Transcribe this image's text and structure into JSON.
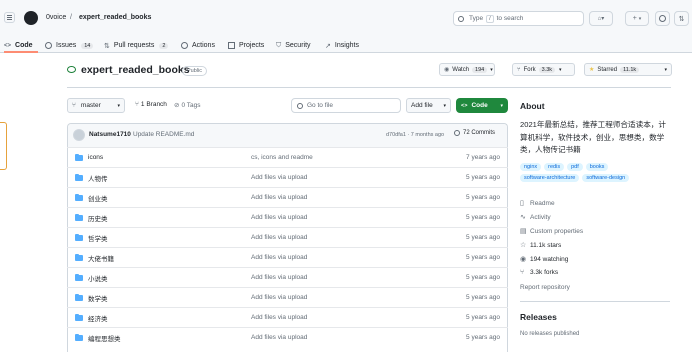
{
  "header": {
    "owner": "0voice",
    "separator": "/",
    "repo": "expert_readed_books",
    "search_placeholder_pre": "Type",
    "search_key": "/",
    "search_placeholder_post": "to search",
    "plus": "+"
  },
  "nav_tabs": [
    {
      "label": "Code"
    },
    {
      "label": "Issues",
      "count": "14"
    },
    {
      "label": "Pull requests",
      "count": "2"
    },
    {
      "label": "Actions"
    },
    {
      "label": "Projects"
    },
    {
      "label": "Security"
    },
    {
      "label": "Insights"
    }
  ],
  "repo": {
    "name": "expert_readed_books",
    "visibility": "Public",
    "watch_label": "Watch",
    "watch_count": "194",
    "fork_label": "Fork",
    "fork_count": "3.3k",
    "star_label": "Starred",
    "star_count": "11.1k"
  },
  "toolbar": {
    "branch": "master",
    "branches": "1 Branch",
    "tags": "0 Tags",
    "goto_placeholder": "Go to file",
    "add_file": "Add file",
    "code_button": "Code"
  },
  "commit": {
    "author": "Natsume1710",
    "message": "Update README.md",
    "sha": "d70dfa1 · 7 months ago",
    "commits": "72 Commits"
  },
  "files": [
    {
      "name": "icons",
      "message": "cs, icons and readme",
      "date": "7 years ago"
    },
    {
      "name": "人物传",
      "message": "Add files via upload",
      "date": "5 years ago"
    },
    {
      "name": "创业类",
      "message": "Add files via upload",
      "date": "5 years ago"
    },
    {
      "name": "历史类",
      "message": "Add files via upload",
      "date": "5 years ago"
    },
    {
      "name": "哲学类",
      "message": "Add files via upload",
      "date": "5 years ago"
    },
    {
      "name": "大佬书籍",
      "message": "Add files via upload",
      "date": "5 years ago"
    },
    {
      "name": "小说类",
      "message": "Add files via upload",
      "date": "5 years ago"
    },
    {
      "name": "数学类",
      "message": "Add files via upload",
      "date": "5 years ago"
    },
    {
      "name": "经济类",
      "message": "Add files via upload",
      "date": "5 years ago"
    },
    {
      "name": "编程思想类",
      "message": "Add files via upload",
      "date": "5 years ago"
    }
  ],
  "about": {
    "heading": "About",
    "description": "2021年最新总结，推荐工程师合适读本，计算机科学，软件技术，创业，思想类，数学类，人物传记书籍",
    "topics": [
      "nginx",
      "redis",
      "pdf",
      "books",
      "software-architecture",
      "software-design"
    ],
    "readme": "Readme",
    "activity": "Activity",
    "custom_properties": "Custom properties",
    "stars": "11.1k stars",
    "watching": "194 watching",
    "forks": "3.3k forks",
    "report": "Report repository"
  },
  "releases": {
    "heading": "Releases",
    "empty": "No releases published"
  },
  "colors": {
    "green": "#1f883d",
    "link": "#0969da",
    "border": "#d0d7de"
  }
}
